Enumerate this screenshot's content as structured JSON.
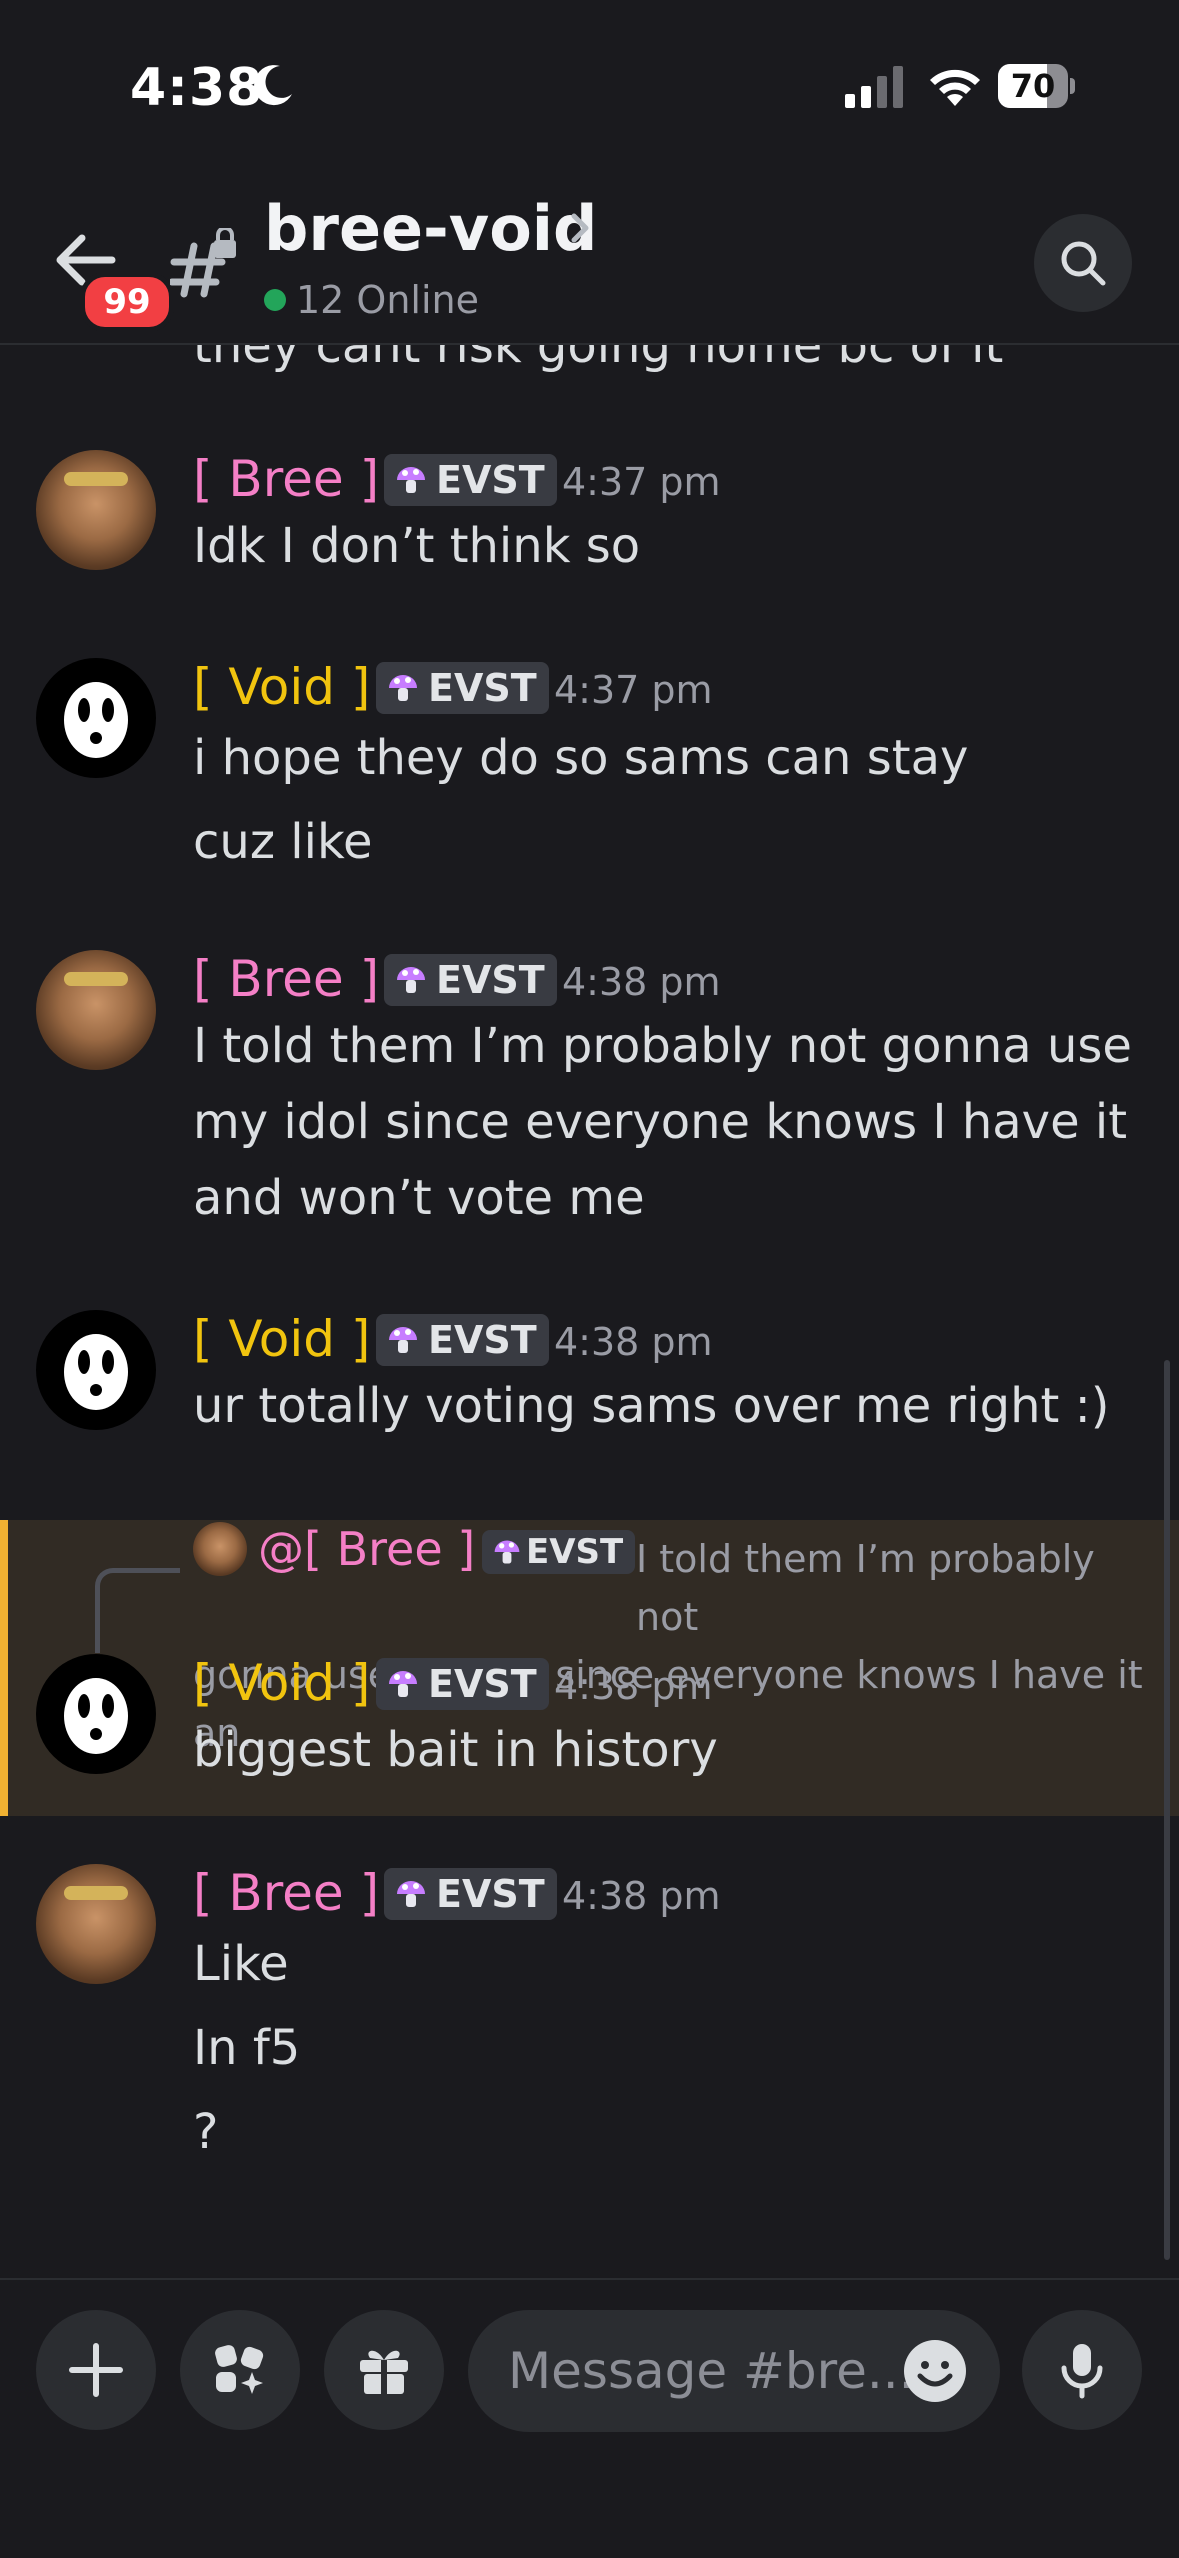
{
  "status_bar": {
    "time": "4:38",
    "battery": "70"
  },
  "header": {
    "back_badge": "99",
    "channel_name": "bree-void",
    "online": "12 Online"
  },
  "cut_off_message": "they cant risk going home bc of it",
  "messages": [
    {
      "author": "[ Bree ]",
      "tag": "EVST",
      "time": "4:37 pm",
      "lines": [
        "Idk I don’t think so"
      ]
    },
    {
      "author": "[ Void ]",
      "tag": "EVST",
      "time": "4:37 pm",
      "lines": [
        "i hope they do so sams can stay",
        "cuz like"
      ]
    },
    {
      "author": "[ Bree ]",
      "tag": "EVST",
      "time": "4:38 pm",
      "lines": [
        "I told them I’m probably not gonna use",
        "my idol since everyone knows I have it",
        "and won’t vote me"
      ]
    },
    {
      "author": "[ Void ]",
      "tag": "EVST",
      "time": "4:38 pm",
      "lines": [
        "ur totally voting sams over me right :)"
      ]
    },
    {
      "author": "[ Void ]",
      "tag": "EVST",
      "time": "4:38 pm",
      "lines": [
        "biggest bait in history"
      ]
    },
    {
      "author": "[ Bree ]",
      "tag": "EVST",
      "time": "4:38 pm",
      "lines": [
        "Like",
        "In f5",
        "?"
      ]
    }
  ],
  "reply": {
    "name": "@[ Bree ]",
    "tag": "EVST",
    "preview_line1": "I told them I’m probably not",
    "preview_line2": "gonna use my idol since everyone knows I have it an..."
  },
  "composer": {
    "placeholder": "Message #bre..."
  },
  "colors": {
    "bree": "#f47fc6",
    "void": "#f1c40f",
    "reply_highlight": "#f0b132",
    "online": "#23a55a",
    "badge": "#f23f43"
  },
  "icons": [
    "moon-icon",
    "signal-icon",
    "wifi-icon",
    "back-arrow-icon",
    "locked-channel-icon",
    "chevron-right-icon",
    "search-icon",
    "mushroom-icon",
    "plus-icon",
    "apps-icon",
    "gift-icon",
    "emoji-icon",
    "microphone-icon"
  ]
}
